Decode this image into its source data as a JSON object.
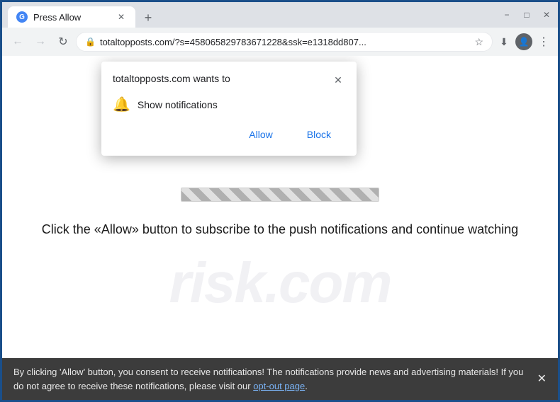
{
  "browser": {
    "tab": {
      "title": "Press Allow",
      "favicon_label": "G"
    },
    "new_tab_label": "+",
    "window_controls": {
      "minimize": "−",
      "maximize": "□",
      "close": "✕"
    },
    "nav": {
      "back_label": "←",
      "forward_label": "→",
      "reload_label": "↻",
      "url": "totaltopposts.com/?s=458065829783671228&ssk=e1318dd807...",
      "lock_icon": "🔒",
      "star_label": "☆",
      "profile_label": "👤",
      "menu_label": "⋮",
      "download_icon": "⬇"
    }
  },
  "permission_popup": {
    "title": "totaltopposts.com wants to",
    "close_label": "✕",
    "notification_icon": "🔔",
    "notification_text": "Show notifications",
    "allow_label": "Allow",
    "block_label": "Block"
  },
  "page": {
    "watermark_top": "risk",
    "watermark_bottom": "risk.com",
    "instruction_text": "Click the «Allow» button to subscribe to the push notifications and continue watching"
  },
  "bottom_bar": {
    "text": "By clicking 'Allow' button, you consent to receive notifications! The notifications provide news and advertising materials! If you do not agree to receive these notifications, please visit our ",
    "link_text": "opt-out page",
    "text_suffix": ".",
    "close_label": "✕"
  }
}
